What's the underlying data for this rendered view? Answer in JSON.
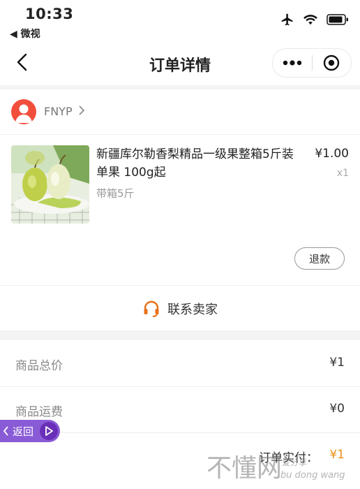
{
  "status_bar": {
    "time": "10:33",
    "back_app": "◀ 微视"
  },
  "nav": {
    "title": "订单详情",
    "more_icon": "more-dots-icon",
    "close_icon": "record-target-icon"
  },
  "shop": {
    "name": "FNYP"
  },
  "item": {
    "title": "新疆库尔勒香梨精品一级果整箱5斤装单果 100g起",
    "spec": "带箱5斤",
    "price": "¥1.00",
    "quantity": "x1",
    "refund_label": "退款"
  },
  "contact": {
    "label": "联系卖家"
  },
  "fees": [
    {
      "label": "商品总价",
      "value": "¥1"
    },
    {
      "label": "商品运费",
      "value": "¥0"
    }
  ],
  "paid": {
    "label": "订单实付：",
    "value": "¥1"
  },
  "floating": {
    "back_label": "返回"
  },
  "watermark": {
    "main": "不懂网",
    "sub": "爱分享",
    "pinyin": "bu dong wang"
  },
  "colors": {
    "accent": "#e8911a",
    "avatar": "#f24e3c",
    "floating": "#8a5bd6",
    "contact_icon": "#e8711a"
  }
}
